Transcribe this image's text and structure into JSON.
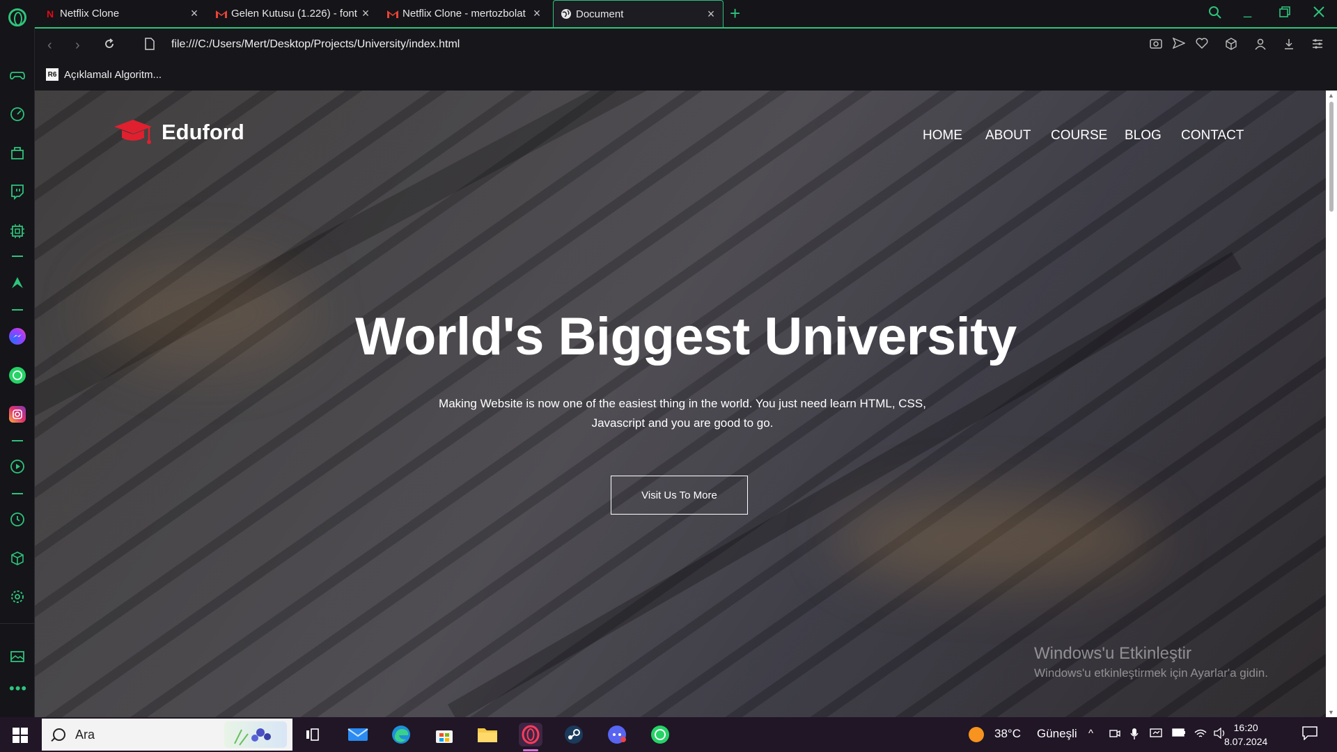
{
  "browser": {
    "tabs": [
      {
        "title": "Netflix Clone",
        "favicon": "netflix-icon",
        "active": false
      },
      {
        "title": "Gelen Kutusu (1.226) - font",
        "favicon": "gmail-icon",
        "active": false
      },
      {
        "title": "Netflix Clone - mertozbolat",
        "favicon": "gmail-icon",
        "active": false
      },
      {
        "title": "Document",
        "favicon": "globe-icon",
        "active": true
      }
    ],
    "new_tab": "+",
    "url": "file:///C:/Users/Mert/Desktop/Projects/University/index.html",
    "bookmarks": [
      {
        "label": "Açıklamalı Algoritm...",
        "icon": "R6"
      }
    ],
    "accent_color": "#2ec47a"
  },
  "page": {
    "brand": "Eduford",
    "brand_icon": "graduation-cap-icon",
    "brand_color": "#e0202e",
    "nav": [
      "HOME",
      "ABOUT",
      "COURSE",
      "BLOG",
      "CONTACT"
    ],
    "hero": {
      "title": "World's Biggest University",
      "subtitle_line1": "Making Website is now one of the easiest thing in the world. You just need learn HTML, CSS,",
      "subtitle_line2": "Javascript and you are good to go.",
      "button": "Visit Us To More"
    },
    "activation": {
      "title": "Windows'u Etkinleştir",
      "subtitle": "Windows'u etkinleştirmek için Ayarlar'a gidin."
    }
  },
  "taskbar": {
    "search_placeholder": "Ara",
    "weather_temp": "38°C",
    "weather_desc": "Güneşli",
    "time": "16:20",
    "date": "8.07.2024"
  }
}
